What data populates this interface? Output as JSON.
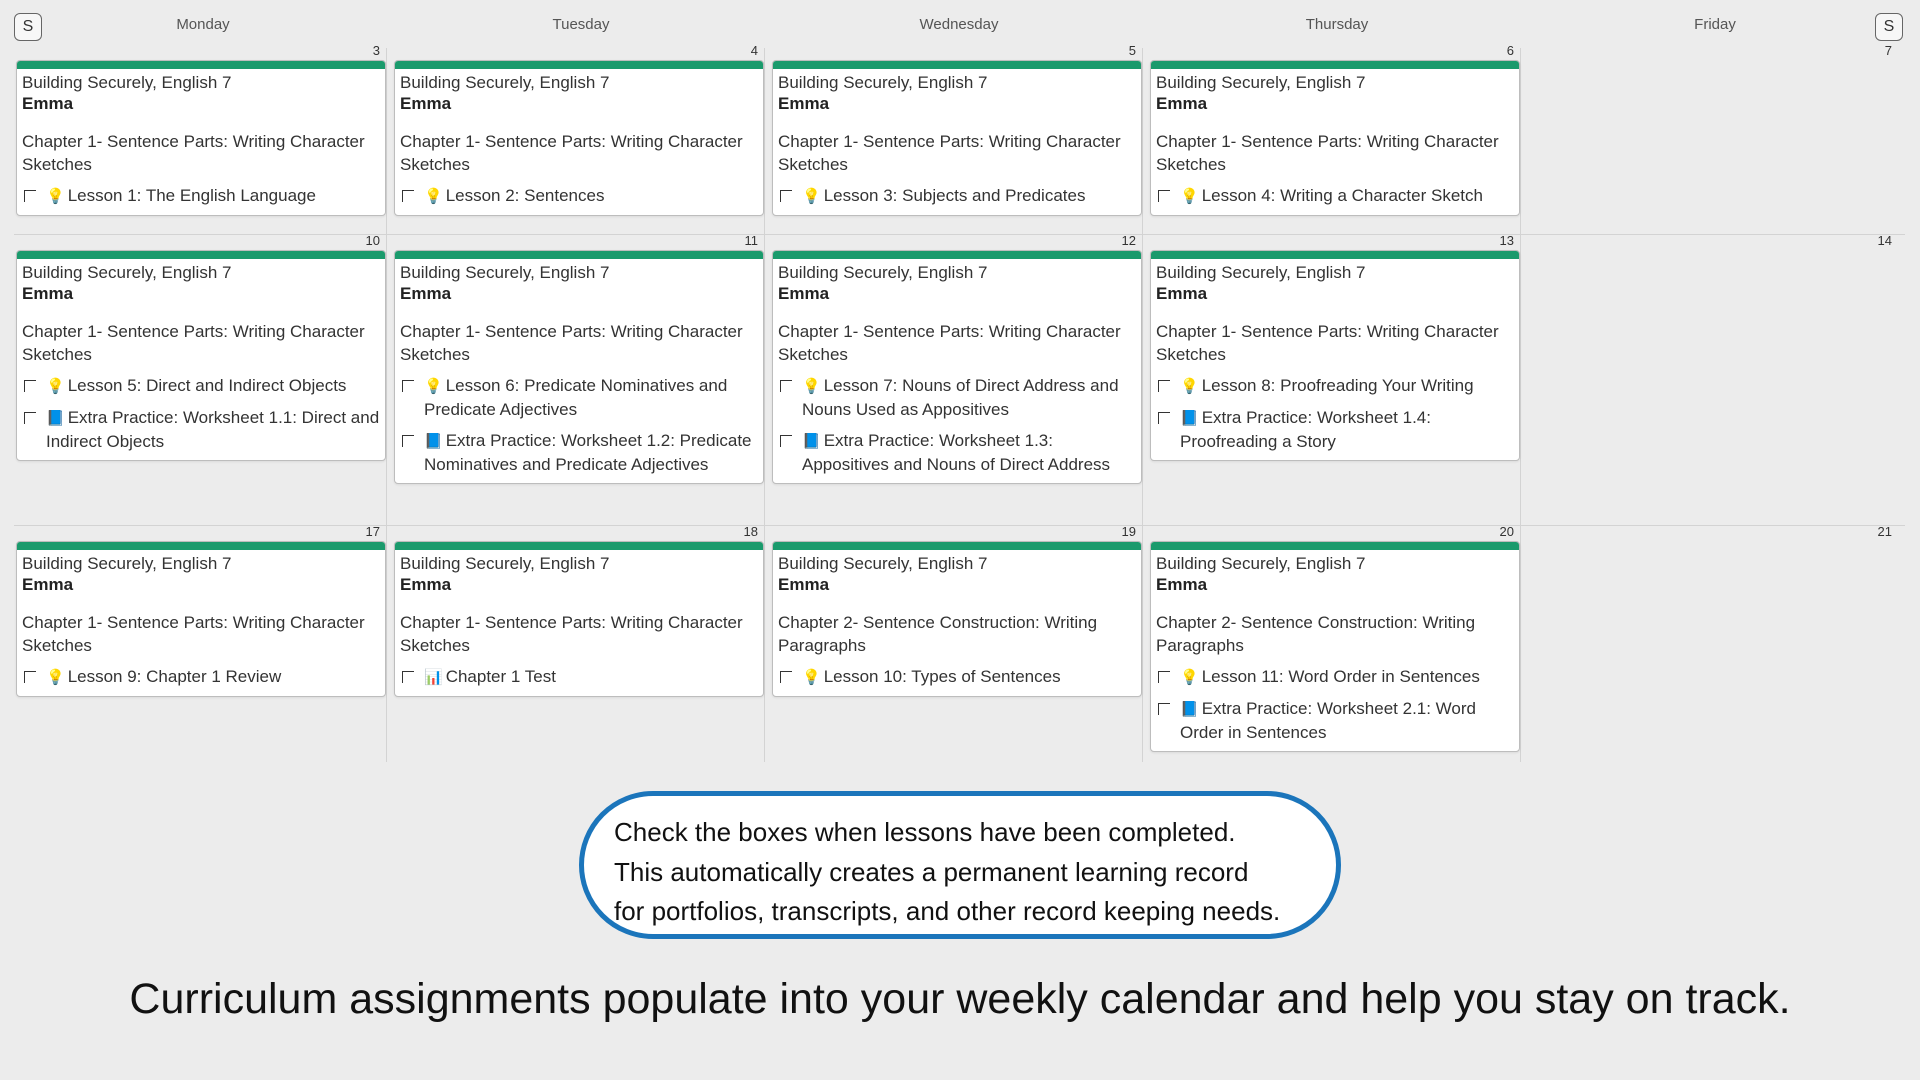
{
  "header": {
    "prev_toggle": "S",
    "next_toggle": "S",
    "days": [
      "Monday",
      "Tuesday",
      "Wednesday",
      "Thursday",
      "Friday"
    ]
  },
  "colors": {
    "course_bar": "#1a9a6c",
    "bubble_border": "#1b75bb"
  },
  "weeks": [
    {
      "dates": [
        "3",
        "4",
        "5",
        "6",
        "7"
      ],
      "cells": [
        {
          "course": "Building Securely, English 7",
          "student": "Emma",
          "chapter": "Chapter 1- Sentence Parts: Writing Character Sketches",
          "tasks": [
            {
              "icon": "lightbulb-icon",
              "glyph": "💡",
              "text": "Lesson 1: The English Language"
            }
          ]
        },
        {
          "course": "Building Securely, English 7",
          "student": "Emma",
          "chapter": "Chapter 1- Sentence Parts: Writing Character Sketches",
          "tasks": [
            {
              "icon": "lightbulb-icon",
              "glyph": "💡",
              "text": "Lesson 2: Sentences"
            }
          ]
        },
        {
          "course": "Building Securely, English 7",
          "student": "Emma",
          "chapter": "Chapter 1- Sentence Parts: Writing Character Sketches",
          "tasks": [
            {
              "icon": "lightbulb-icon",
              "glyph": "💡",
              "text": "Lesson 3: Subjects and Predicates"
            }
          ]
        },
        {
          "course": "Building Securely, English 7",
          "student": "Emma",
          "chapter": "Chapter 1- Sentence Parts: Writing Character Sketches",
          "tasks": [
            {
              "icon": "lightbulb-icon",
              "glyph": "💡",
              "text": "Lesson 4: Writing a Character Sketch"
            }
          ]
        },
        null
      ]
    },
    {
      "dates": [
        "10",
        "11",
        "12",
        "13",
        "14"
      ],
      "cells": [
        {
          "course": "Building Securely, English 7",
          "student": "Emma",
          "chapter": "Chapter 1- Sentence Parts: Writing Character Sketches",
          "tasks": [
            {
              "icon": "lightbulb-icon",
              "glyph": "💡",
              "text": "Lesson 5: Direct and Indirect Objects"
            },
            {
              "icon": "book-icon",
              "glyph": "📘",
              "text": "Extra Practice: Worksheet 1.1: Direct and Indirect Objects"
            }
          ]
        },
        {
          "course": "Building Securely, English 7",
          "student": "Emma",
          "chapter": "Chapter 1- Sentence Parts: Writing Character Sketches",
          "tasks": [
            {
              "icon": "lightbulb-icon",
              "glyph": "💡",
              "text": "Lesson 6: Predicate Nominatives and Predicate Adjectives"
            },
            {
              "icon": "book-icon",
              "glyph": "📘",
              "text": "Extra Practice: Worksheet 1.2: Predicate Nominatives and Predicate Adjectives"
            }
          ]
        },
        {
          "course": "Building Securely, English 7",
          "student": "Emma",
          "chapter": "Chapter 1- Sentence Parts: Writing Character Sketches",
          "tasks": [
            {
              "icon": "lightbulb-icon",
              "glyph": "💡",
              "text": "Lesson 7: Nouns of Direct Address and Nouns Used as Appositives"
            },
            {
              "icon": "book-icon",
              "glyph": "📘",
              "text": "Extra Practice: Worksheet 1.3: Appositives and Nouns of Direct Address"
            }
          ]
        },
        {
          "course": "Building Securely, English 7",
          "student": "Emma",
          "chapter": "Chapter 1- Sentence Parts: Writing Character Sketches",
          "tasks": [
            {
              "icon": "lightbulb-icon",
              "glyph": "💡",
              "text": "Lesson 8: Proofreading Your Writing"
            },
            {
              "icon": "book-icon",
              "glyph": "📘",
              "text": "Extra Practice: Worksheet 1.4: Proofreading a Story"
            }
          ]
        },
        null
      ]
    },
    {
      "dates": [
        "17",
        "18",
        "19",
        "20",
        "21"
      ],
      "cells": [
        {
          "course": "Building Securely, English 7",
          "student": "Emma",
          "chapter": "Chapter 1- Sentence Parts: Writing Character Sketches",
          "tasks": [
            {
              "icon": "lightbulb-icon",
              "glyph": "💡",
              "text": "Lesson 9: Chapter 1 Review"
            }
          ]
        },
        {
          "course": "Building Securely, English 7",
          "student": "Emma",
          "chapter": "Chapter 1- Sentence Parts: Writing Character Sketches",
          "tasks": [
            {
              "icon": "chart-icon",
              "glyph": "📊",
              "text": "Chapter 1 Test"
            }
          ]
        },
        {
          "course": "Building Securely, English 7",
          "student": "Emma",
          "chapter": "Chapter 2- Sentence Construction: Writing Paragraphs",
          "tasks": [
            {
              "icon": "lightbulb-icon",
              "glyph": "💡",
              "text": "Lesson 10: Types of Sentences"
            }
          ]
        },
        {
          "course": "Building Securely, English 7",
          "student": "Emma",
          "chapter": "Chapter 2- Sentence Construction: Writing Paragraphs",
          "tasks": [
            {
              "icon": "lightbulb-icon",
              "glyph": "💡",
              "text": "Lesson 11: Word Order in Sentences"
            },
            {
              "icon": "book-icon",
              "glyph": "📘",
              "text": "Extra Practice: Worksheet 2.1: Word Order in Sentences"
            }
          ]
        },
        null
      ]
    }
  ],
  "callout": {
    "lines": [
      "Check the boxes when lessons have been completed.",
      "This automatically creates a permanent learning record",
      "for portfolios, transcripts, and other record keeping needs."
    ]
  },
  "caption": "Curriculum assignments populate into your weekly calendar and help you stay on track."
}
